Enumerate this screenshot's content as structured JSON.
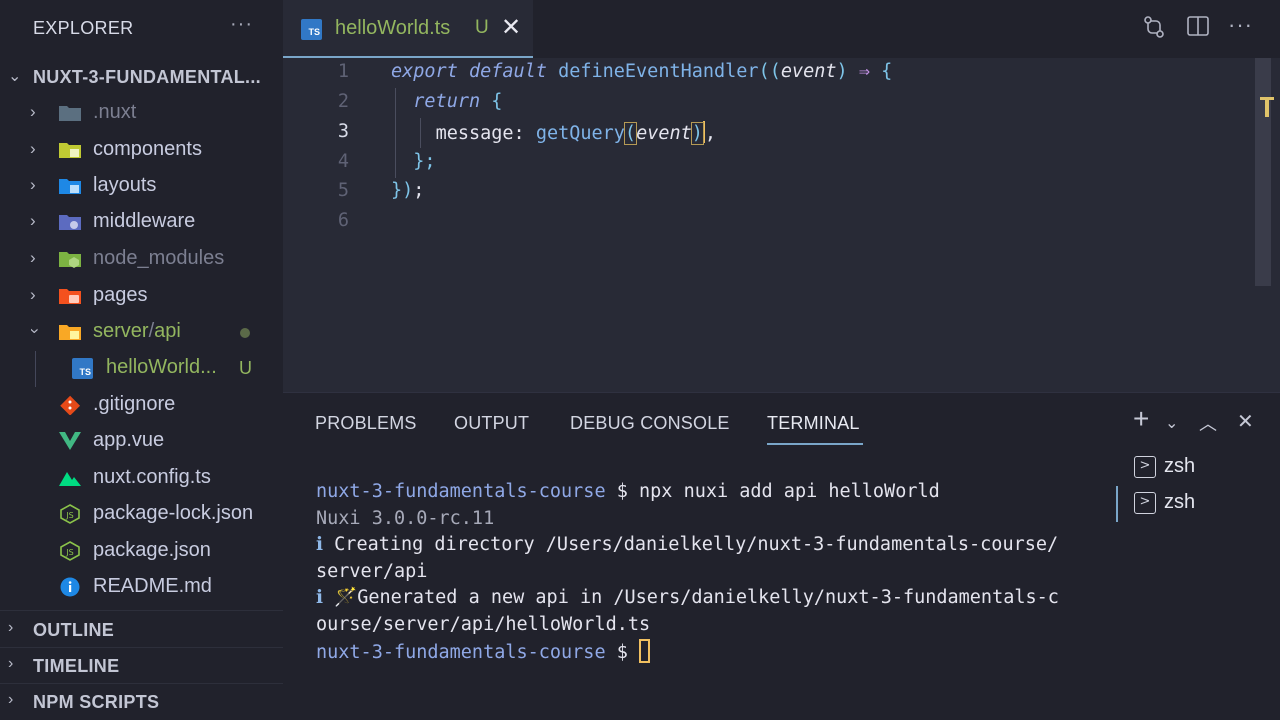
{
  "sidebar": {
    "title": "EXPLORER",
    "more": "···",
    "project": "NUXT-3-FUNDAMENTAL...",
    "items": [
      {
        "label": ".nuxt"
      },
      {
        "label": "components"
      },
      {
        "label": "layouts"
      },
      {
        "label": "middleware"
      },
      {
        "label": "node_modules"
      },
      {
        "label": "pages"
      },
      {
        "label": "server",
        "sep": "/",
        "label2": "api"
      },
      {
        "label": "helloWorld...",
        "badge": "U"
      },
      {
        "label": ".gitignore"
      },
      {
        "label": "app.vue"
      },
      {
        "label": "nuxt.config.ts"
      },
      {
        "label": "package-lock.json"
      },
      {
        "label": "package.json"
      },
      {
        "label": "README.md"
      }
    ],
    "sections": [
      "OUTLINE",
      "TIMELINE",
      "NPM SCRIPTS"
    ]
  },
  "editor": {
    "tab": {
      "title": "helloWorld.ts",
      "status": "U",
      "icon_text": "TS"
    },
    "line_numbers": [
      "1",
      "2",
      "3",
      "4",
      "5",
      "6"
    ],
    "code": {
      "l1_export": "export",
      "l1_default": "default",
      "l1_fn": "defineEventHandler",
      "l1_open": "((",
      "l1_arg": "event",
      "l1_close": ")",
      "l1_arrow": "⇒",
      "l1_brace": "{",
      "l2_return": "return",
      "l2_brace": "{",
      "l3_key": "message:",
      "l3_fn": "getQuery",
      "l3_open": "(",
      "l3_arg": "event",
      "l3_close": ")",
      "l3_comma": ",",
      "l4": "};",
      "l5_close": "})",
      "l5_semi": ";"
    }
  },
  "panel": {
    "tabs": [
      "PROBLEMS",
      "OUTPUT",
      "DEBUG CONSOLE",
      "TERMINAL"
    ],
    "active_tab": "TERMINAL",
    "terminal": {
      "prompt_path": "nuxt-3-fundamentals-course",
      "prompt_sym": "$",
      "command": "npx nuxi add api helloWorld",
      "version": "Nuxi 3.0.0-rc.11",
      "info1_icon": "ℹ",
      "info1_a": "Creating directory /Users/danielkelly/nuxt-3-fundamentals-course/",
      "info1_b": "server/api",
      "info2_icon": "ℹ",
      "info2_a": "🪄Generated a new api in /Users/danielkelly/nuxt-3-fundamentals-c",
      "info2_b": "ourse/server/api/helloWorld.ts"
    },
    "sessions": [
      "zsh",
      "zsh"
    ]
  },
  "colors": {
    "accent": "#7aa6c9",
    "modified": "#93b65f",
    "background": "#282a36"
  }
}
